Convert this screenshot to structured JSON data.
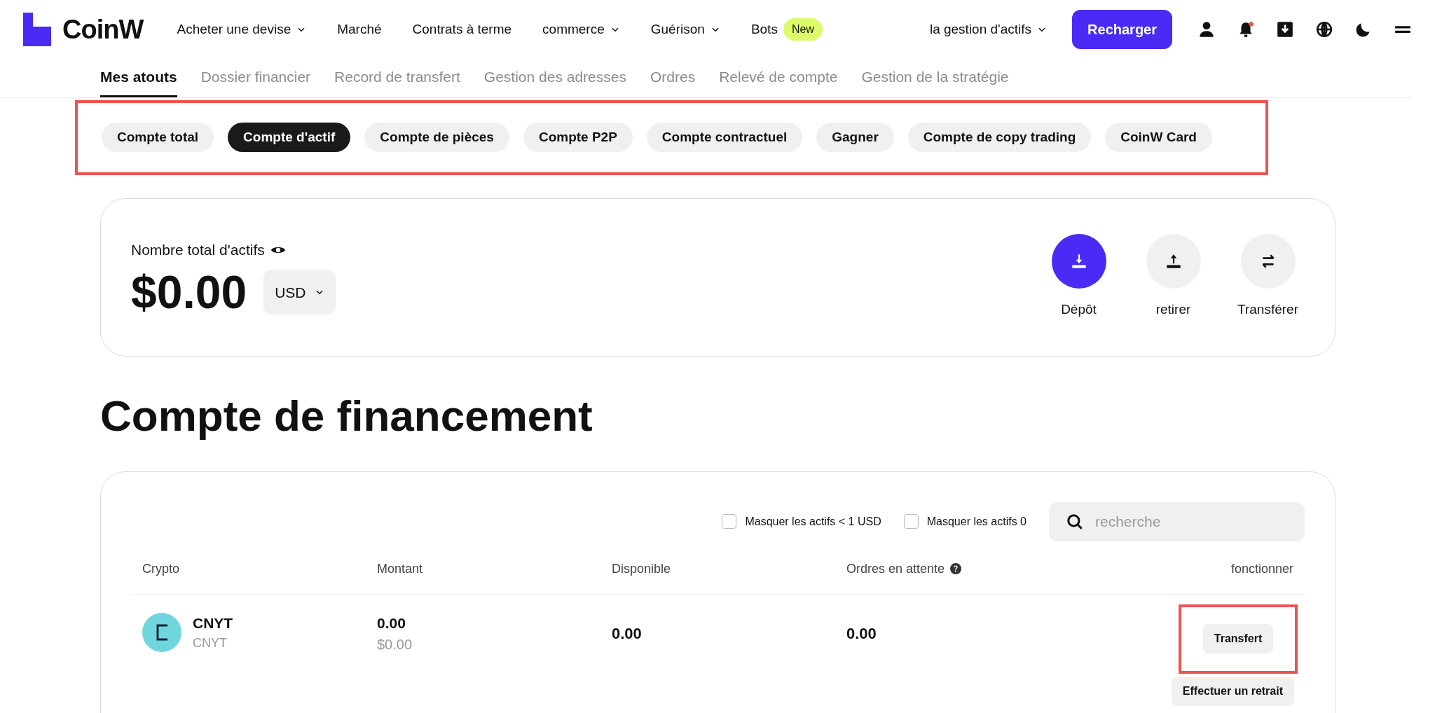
{
  "header": {
    "logo": "CoinW",
    "nav": [
      {
        "label": "Acheter une devise",
        "dropdown": true
      },
      {
        "label": "Marché",
        "dropdown": false
      },
      {
        "label": "Contrats à terme",
        "dropdown": false
      },
      {
        "label": "commerce",
        "dropdown": true
      },
      {
        "label": "Guérison",
        "dropdown": true
      },
      {
        "label": "Bots",
        "dropdown": false,
        "badge": "New"
      }
    ],
    "asset_menu": "la gestion d'actifs",
    "cta": "Recharger",
    "notification_dot": true
  },
  "subtabs": [
    {
      "label": "Mes atouts",
      "selected": true
    },
    {
      "label": "Dossier financier",
      "selected": false
    },
    {
      "label": "Record de transfert",
      "selected": false
    },
    {
      "label": "Gestion des adresses",
      "selected": false
    },
    {
      "label": "Ordres",
      "selected": false
    },
    {
      "label": "Relevé de compte",
      "selected": false
    },
    {
      "label": "Gestion de la stratégie",
      "selected": false
    }
  ],
  "account_pills": [
    {
      "label": "Compte total",
      "selected": false
    },
    {
      "label": "Compte d'actif",
      "selected": true
    },
    {
      "label": "Compte de pièces",
      "selected": false
    },
    {
      "label": "Compte P2P",
      "selected": false
    },
    {
      "label": "Compte contractuel",
      "selected": false
    },
    {
      "label": "Gagner",
      "selected": false
    },
    {
      "label": "Compte de copy trading",
      "selected": false
    },
    {
      "label": "CoinW Card",
      "selected": false
    }
  ],
  "total": {
    "label": "Nombre total d'actifs",
    "amount": "$0.00",
    "currency": "USD",
    "actions": [
      {
        "kind": "deposit",
        "label": "Dépôt",
        "primary": true
      },
      {
        "kind": "withdraw",
        "label": "retirer",
        "primary": false
      },
      {
        "kind": "transfer",
        "label": "Transférer",
        "primary": false
      }
    ]
  },
  "section_title": "Compte de financement",
  "filters": [
    {
      "label": "Masquer les actifs < 1 USD",
      "checked": false
    },
    {
      "label": "Masquer les actifs 0",
      "checked": false
    }
  ],
  "search": {
    "placeholder": "recherche"
  },
  "table": {
    "columns": [
      {
        "label": "Crypto",
        "help": false
      },
      {
        "label": "Montant",
        "help": false
      },
      {
        "label": "Disponible",
        "help": false
      },
      {
        "label": "Ordres en attente",
        "help": true
      },
      {
        "label": "fonctionner",
        "help": false
      }
    ],
    "rows": [
      {
        "symbol": "CNYT",
        "name": "CNYT",
        "amount": "0.00",
        "amount_usd": "$0.00",
        "available": "0.00",
        "pending": "0.00",
        "actions": [
          "Transfert",
          "Effectuer un retrait"
        ]
      }
    ]
  }
}
